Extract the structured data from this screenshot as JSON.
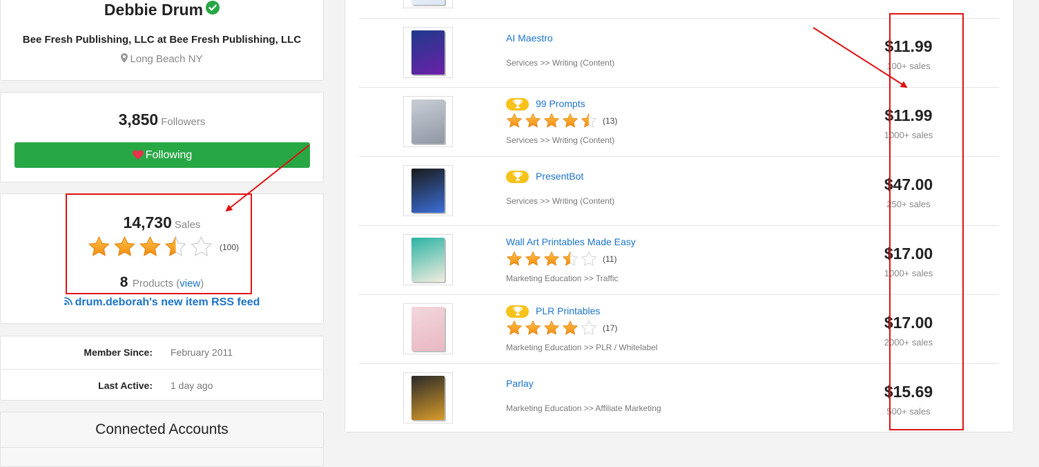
{
  "seller": {
    "name": "Debbie Drum",
    "company": "Bee Fresh Publishing, LLC at Bee Fresh Publishing, LLC",
    "location": "Long Beach NY",
    "followers_count": "3,850",
    "followers_label": "Followers",
    "follow_button": "Following",
    "sales_count": "14,730",
    "sales_label": "Sales",
    "rating": 3.5,
    "rating_count": "(100)",
    "products_count": "8",
    "products_label": "Products (",
    "products_view": "view",
    "products_close": ")",
    "rss_label": "drum.deborah's new item RSS feed",
    "member_since_label": "Member Since:",
    "member_since_value": "February 2011",
    "last_active_label": "Last Active:",
    "last_active_value": "1 day ago",
    "connected_accounts": "Connected Accounts"
  },
  "products": [
    {
      "name": "AI Maestro",
      "trophy": false,
      "rating": null,
      "reviews": "",
      "category": "Services >> Writing (Content)",
      "price": "$11.99",
      "sales": "100+ sales",
      "cover": "#1f3a8a",
      "cover2": "#6b21a8"
    },
    {
      "name": "99 Prompts",
      "trophy": true,
      "rating": 4.5,
      "reviews": "(13)",
      "category": "Services >> Writing (Content)",
      "price": "$11.99",
      "sales": "1000+ sales",
      "cover": "#c9ced6",
      "cover2": "#8f97a3"
    },
    {
      "name": "PresentBot",
      "trophy": true,
      "rating": null,
      "reviews": "",
      "category": "Services >> Writing (Content)",
      "price": "$47.00",
      "sales": "250+ sales",
      "cover": "#1b1b1b",
      "cover2": "#3b6fd8"
    },
    {
      "name": "Wall Art Printables Made Easy",
      "trophy": false,
      "rating": 3.5,
      "reviews": "(11)",
      "category": "Marketing Education >> Traffic",
      "price": "$17.00",
      "sales": "1000+ sales",
      "cover": "#2bb3a3",
      "cover2": "#f2ecdf"
    },
    {
      "name": "PLR Printables",
      "trophy": true,
      "rating": 4,
      "reviews": "(17)",
      "category": "Marketing Education >> PLR / Whitelabel",
      "price": "$17.00",
      "sales": "2000+ sales",
      "cover": "#f3d7dd",
      "cover2": "#e8b7c2"
    },
    {
      "name": "Parlay",
      "trophy": false,
      "rating": null,
      "reviews": "",
      "category": "Marketing Education >> Affiliate Marketing",
      "price": "$15.69",
      "sales": "500+ sales",
      "cover": "#2a2a2a",
      "cover2": "#d89b2b"
    }
  ],
  "colors": {
    "accent_link": "#1a73c9",
    "follow_green": "#28a745",
    "star_orange": "#f7941d",
    "annotation_red": "#e01010",
    "verified_green": "#28a745"
  }
}
